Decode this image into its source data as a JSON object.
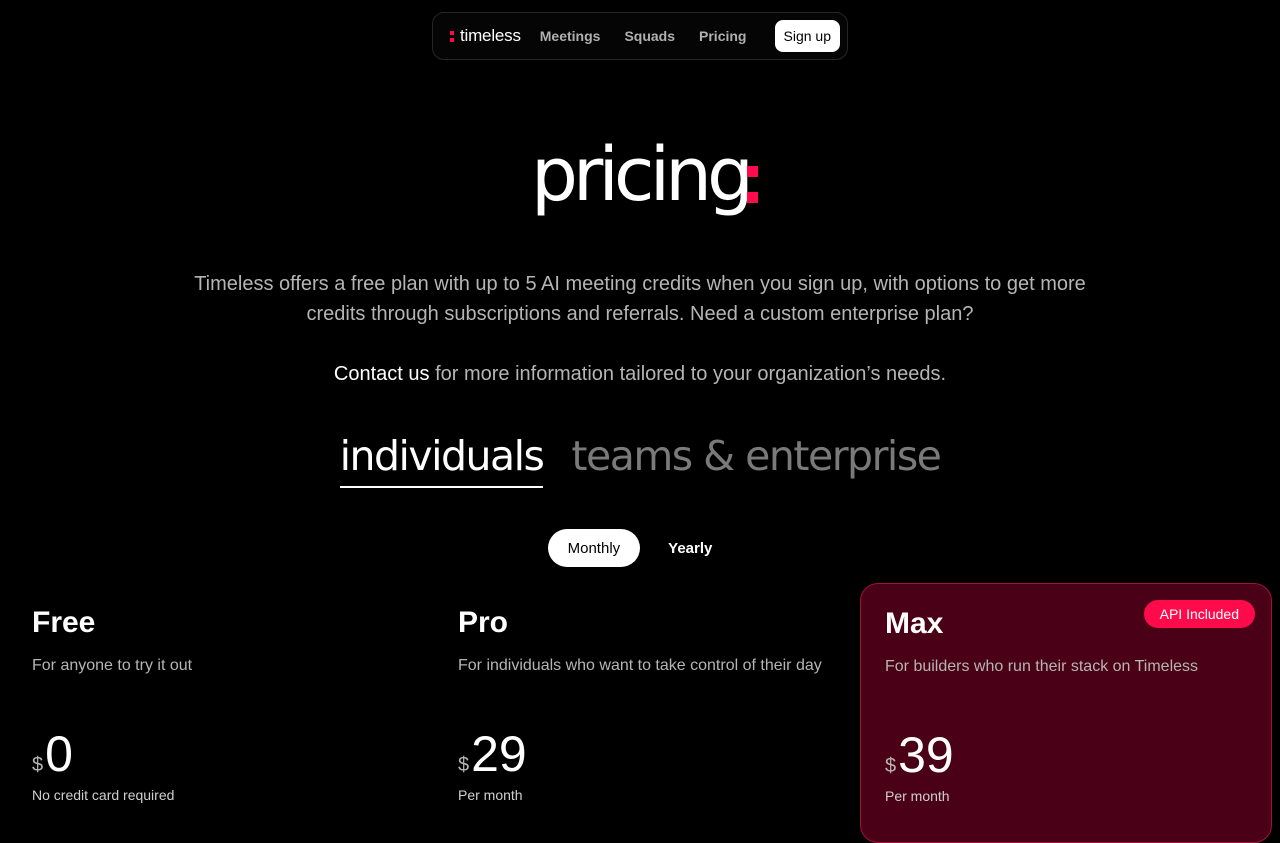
{
  "nav": {
    "logo_text": "timeless",
    "links": [
      "Meetings",
      "Squads",
      "Pricing"
    ],
    "signup_label": "Sign up"
  },
  "hero": {
    "title": "pricing",
    "intro": "Timeless offers a free plan with up to 5 AI meeting credits when you sign up, with options to get more credits through subscriptions and referrals. Need a custom enterprise plan?",
    "contact_link": "Contact us",
    "contact_rest": " for more information tailored to your organization’s needs."
  },
  "segments": {
    "active": "individuals",
    "inactive": "teams & enterprise"
  },
  "billing": {
    "monthly": "Monthly",
    "yearly": "Yearly"
  },
  "plans": [
    {
      "name": "Free",
      "desc": "For anyone to try it out",
      "currency": "$",
      "price": "0",
      "note": "No credit card required"
    },
    {
      "name": "Pro",
      "desc": "For individuals who want to take control of their day",
      "currency": "$",
      "price": "29",
      "note": "Per month"
    },
    {
      "name": "Max",
      "desc": "For builders who run their stack on Timeless",
      "currency": "$",
      "price": "39",
      "note": "Per month",
      "badge": "API Included"
    }
  ],
  "colors": {
    "accent": "#ff0a4a",
    "max_card_bg": "#4a0016"
  }
}
